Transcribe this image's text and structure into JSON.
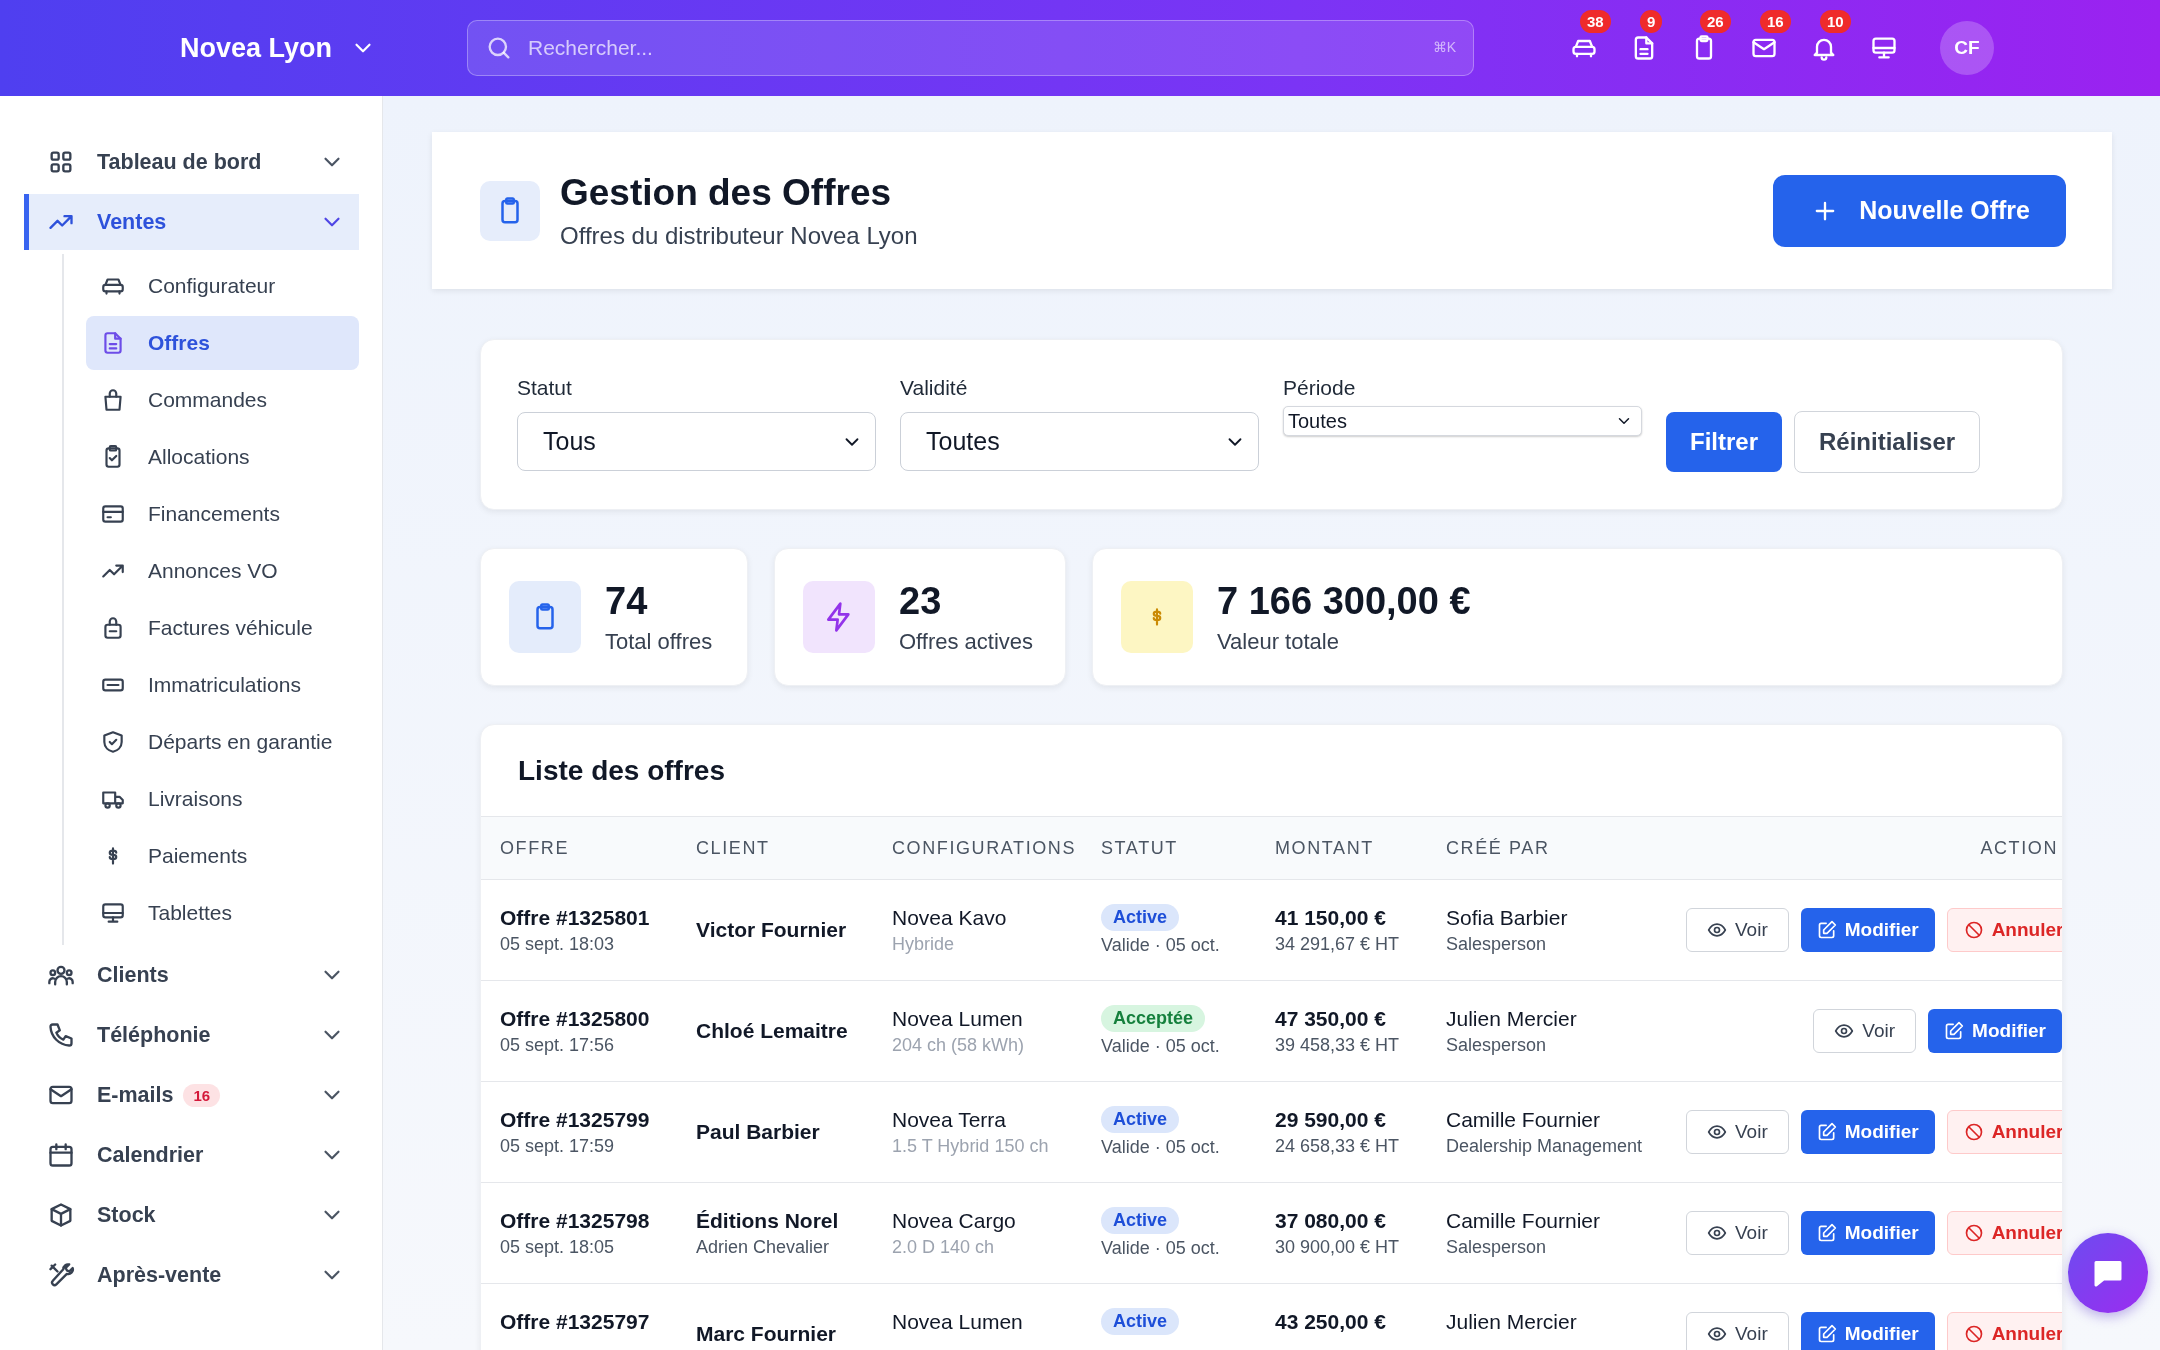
{
  "topbar": {
    "brand": "Novea Lyon",
    "search": {
      "placeholder": "Rechercher...",
      "shortcut": "⌘K"
    },
    "notifications": [
      {
        "badge": "38"
      },
      {
        "badge": "9"
      },
      {
        "badge": "26"
      },
      {
        "badge": "16"
      },
      {
        "badge": "10"
      }
    ],
    "avatar": "CF"
  },
  "sidebar": {
    "items": [
      {
        "label": "Tableau de bord",
        "selected": false
      },
      {
        "label": "Ventes",
        "selected": true,
        "children": [
          {
            "label": "Configurateur",
            "selected": false
          },
          {
            "label": "Offres",
            "selected": true
          },
          {
            "label": "Commandes",
            "selected": false
          },
          {
            "label": "Allocations",
            "selected": false
          },
          {
            "label": "Financements",
            "selected": false
          },
          {
            "label": "Annonces VO",
            "selected": false
          },
          {
            "label": "Factures véhicule",
            "selected": false
          },
          {
            "label": "Immatriculations",
            "selected": false
          },
          {
            "label": "Départs en garantie",
            "selected": false
          },
          {
            "label": "Livraisons",
            "selected": false
          },
          {
            "label": "Paiements",
            "selected": false
          },
          {
            "label": "Tablettes",
            "selected": false
          }
        ]
      },
      {
        "label": "Clients",
        "selected": false
      },
      {
        "label": "Téléphonie",
        "selected": false
      },
      {
        "label": "E-mails",
        "selected": false,
        "badge": "16"
      },
      {
        "label": "Calendrier",
        "selected": false
      },
      {
        "label": "Stock",
        "selected": false
      },
      {
        "label": "Après-vente",
        "selected": false
      }
    ]
  },
  "header": {
    "title": "Gestion des Offres",
    "subtitle": "Offres du distributeur Novea Lyon",
    "button": "Nouvelle Offre"
  },
  "filters": {
    "fields": [
      {
        "label": "Statut",
        "value": "Tous",
        "kind": "styled"
      },
      {
        "label": "Validité",
        "value": "Toutes",
        "kind": "styled"
      },
      {
        "label": "Période",
        "value": "Toutes",
        "kind": "native"
      }
    ],
    "buttons": [
      {
        "label": "Filtrer",
        "kind": "primary"
      },
      {
        "label": "Réinitialiser",
        "kind": "secondary"
      }
    ]
  },
  "stats": [
    {
      "value": "74",
      "label": "Total offres",
      "kind": "total"
    },
    {
      "value": "23",
      "label": "Offres actives",
      "kind": "active"
    },
    {
      "value": "7 166 300,00 €",
      "label": "Valeur totale",
      "kind": "amount"
    }
  ],
  "table": {
    "title": "Liste des offres",
    "columns": [
      "OFFRE",
      "CLIENT",
      "CONFIGURATIONS",
      "STATUT",
      "MONTANT",
      "CRÉÉ PAR",
      "ACTION"
    ],
    "rows": [
      {
        "offer": "Offre #1325801",
        "date": "05 sept. 18:03",
        "client": "Victor Fournier",
        "model": "Novea Kavo",
        "spec": "Hybride",
        "status": {
          "label": "Active",
          "kind": "active"
        },
        "validity": "Valide · 05 oct.",
        "amount": "41 150,00 €",
        "amount_ht": "34 291,67 € HT",
        "creator": "Sofia Barbier",
        "role": "Salesperson",
        "actions": [
          {
            "label": "Voir",
            "kind": "view"
          },
          {
            "label": "Modifier",
            "kind": "edit"
          },
          {
            "label": "Annuler",
            "kind": "cancel"
          }
        ]
      },
      {
        "offer": "Offre #1325800",
        "date": "05 sept. 17:56",
        "client": "Chloé Lemaitre",
        "model": "Novea Lumen",
        "spec": "204 ch (58 kWh)",
        "status": {
          "label": "Acceptée",
          "kind": "accepted"
        },
        "validity": "Valide · 05 oct.",
        "amount": "47 350,00 €",
        "amount_ht": "39 458,33 € HT",
        "creator": "Julien Mercier",
        "role": "Salesperson",
        "actions": [
          {
            "label": "Voir",
            "kind": "view"
          },
          {
            "label": "Modifier",
            "kind": "edit"
          }
        ]
      },
      {
        "offer": "Offre #1325799",
        "date": "05 sept. 17:59",
        "client": "Paul Barbier",
        "model": "Novea Terra",
        "spec": "1.5 T Hybrid 150 ch",
        "status": {
          "label": "Active",
          "kind": "active"
        },
        "validity": "Valide · 05 oct.",
        "amount": "29 590,00 €",
        "amount_ht": "24 658,33 € HT",
        "creator": "Camille Fournier",
        "role": "Dealership Management",
        "actions": [
          {
            "label": "Voir",
            "kind": "view"
          },
          {
            "label": "Modifier",
            "kind": "edit"
          },
          {
            "label": "Annuler",
            "kind": "cancel"
          }
        ]
      },
      {
        "offer": "Offre #1325798",
        "date": "05 sept. 18:05",
        "client": "Éditions Norel",
        "contact": "Adrien Chevalier",
        "model": "Novea Cargo",
        "spec": "2.0 D 140 ch",
        "status": {
          "label": "Active",
          "kind": "active"
        },
        "validity": "Valide · 05 oct.",
        "amount": "37 080,00 €",
        "amount_ht": "30 900,00 € HT",
        "creator": "Camille Fournier",
        "role": "Salesperson",
        "actions": [
          {
            "label": "Voir",
            "kind": "view"
          },
          {
            "label": "Modifier",
            "kind": "edit"
          },
          {
            "label": "Annuler",
            "kind": "cancel"
          }
        ]
      },
      {
        "offer": "Offre #1325797",
        "client": "Marc Fournier",
        "model": "Novea Lumen",
        "status": {
          "label": "Active",
          "kind": "active"
        },
        "amount": "43 250,00 €",
        "creator": "Julien Mercier",
        "actions": [
          {
            "label": "Voir",
            "kind": "view"
          },
          {
            "label": "Modifier",
            "kind": "edit"
          },
          {
            "label": "Annuler",
            "kind": "cancel"
          }
        ]
      }
    ]
  }
}
